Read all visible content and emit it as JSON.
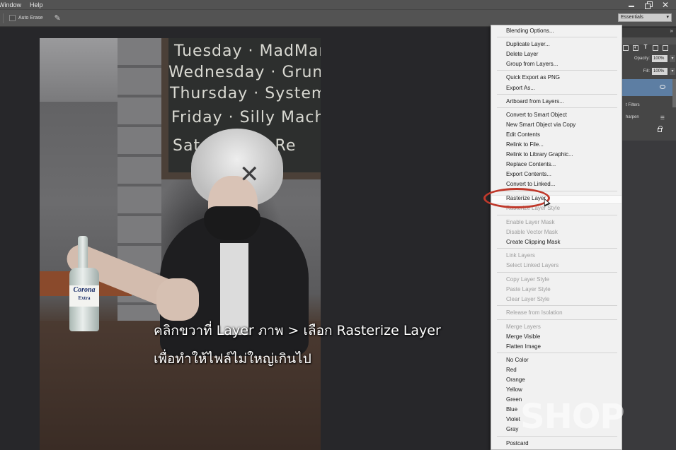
{
  "menubar": {
    "items": [
      "Window",
      "Help"
    ]
  },
  "optionsbar": {
    "auto_erase_label": "Auto Erase",
    "workspace": "Essentials"
  },
  "canvas": {
    "chalkboard_lines": [
      "Tuesday · MadMan",
      "Wednesday · Grunge",
      "Thursday · System",
      "Friday · Silly Mach",
      "Sat · Jimmy Re"
    ],
    "bottle_brand": "Corona",
    "bottle_sub": "Extra",
    "caption_line1": "คลิกขวาที่ Layer ภาพ > เลือก Rasterize Layer",
    "caption_line2": "เพื่อทำให้ไฟล์ไม่ใหญ่เกินไป"
  },
  "layers_panel": {
    "opacity_label": "Opacity:",
    "opacity_value": "100%",
    "fill_label": "Fill:",
    "fill_value": "100%",
    "smart_filters_label": "t Filters",
    "sharpen_label": "harpen"
  },
  "context_menu": {
    "items": [
      {
        "label": "Blending Options...",
        "enabled": true
      },
      {
        "label": "Duplicate Layer...",
        "enabled": true
      },
      {
        "label": "Delete Layer",
        "enabled": true
      },
      {
        "label": "Group from Layers...",
        "enabled": true
      },
      {
        "label": "Quick Export as PNG",
        "enabled": true
      },
      {
        "label": "Export As...",
        "enabled": true
      },
      {
        "label": "Artboard from Layers...",
        "enabled": true
      },
      {
        "label": "Convert to Smart Object",
        "enabled": true
      },
      {
        "label": "New Smart Object via Copy",
        "enabled": true
      },
      {
        "label": "Edit Contents",
        "enabled": true
      },
      {
        "label": "Relink to File...",
        "enabled": true
      },
      {
        "label": "Relink to Library Graphic...",
        "enabled": true
      },
      {
        "label": "Replace Contents...",
        "enabled": true
      },
      {
        "label": "Export Contents...",
        "enabled": true
      },
      {
        "label": "Convert to Linked...",
        "enabled": true
      },
      {
        "label": "Rasterize Layer",
        "enabled": true
      },
      {
        "label": "Rasterize Layer Style",
        "enabled": false
      },
      {
        "label": "Enable Layer Mask",
        "enabled": false
      },
      {
        "label": "Disable Vector Mask",
        "enabled": false
      },
      {
        "label": "Create Clipping Mask",
        "enabled": true
      },
      {
        "label": "Link Layers",
        "enabled": false
      },
      {
        "label": "Select Linked Layers",
        "enabled": false
      },
      {
        "label": "Copy Layer Style",
        "enabled": false
      },
      {
        "label": "Paste Layer Style",
        "enabled": false
      },
      {
        "label": "Clear Layer Style",
        "enabled": false
      },
      {
        "label": "Release from Isolation",
        "enabled": false
      },
      {
        "label": "Merge Layers",
        "enabled": false
      },
      {
        "label": "Merge Visible",
        "enabled": true
      },
      {
        "label": "Flatten Image",
        "enabled": true
      },
      {
        "label": "No Color",
        "enabled": true
      },
      {
        "label": "Red",
        "enabled": true
      },
      {
        "label": "Orange",
        "enabled": true
      },
      {
        "label": "Yellow",
        "enabled": true
      },
      {
        "label": "Green",
        "enabled": true
      },
      {
        "label": "Blue",
        "enabled": true
      },
      {
        "label": "Violet",
        "enabled": true
      },
      {
        "label": "Gray",
        "enabled": true
      },
      {
        "label": "Postcard",
        "enabled": true
      }
    ]
  },
  "watermark": "SHOP",
  "colors": {
    "highlight_oval": "#c0392b",
    "selected_layer": "#5d7ea3"
  }
}
